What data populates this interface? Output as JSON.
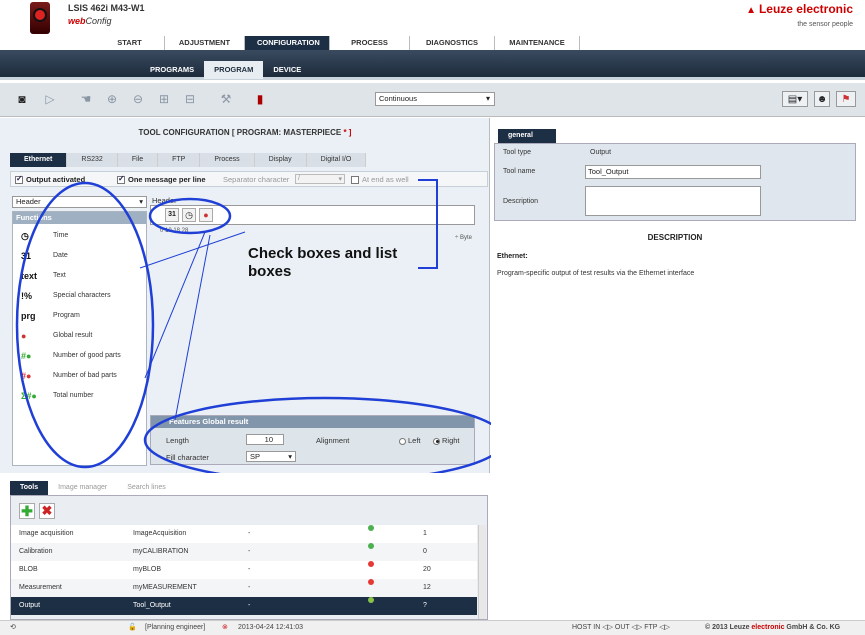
{
  "header": {
    "device_title": "LSIS 462i M43-W1",
    "webconfig_prefix": "web",
    "webconfig_suffix": "Config",
    "brand": "Leuze electronic",
    "slogan": "the sensor people"
  },
  "main_nav": [
    "START",
    "ADJUSTMENT",
    "CONFIGURATION",
    "PROCESS",
    "DIAGNOSTICS",
    "MAINTENANCE"
  ],
  "sub_nav": [
    "PROGRAMS",
    "PROGRAM",
    "DEVICE"
  ],
  "toolbar": {
    "mode": "Continuous"
  },
  "tool_config": {
    "title": "TOOL CONFIGURATION   [ PROGRAM: MASTERPIECE",
    "title_mark": " * ]"
  },
  "tabs": [
    "Ethernet",
    "RS232",
    "File",
    "FTP",
    "Process",
    "Display",
    "Digital I/O"
  ],
  "options": {
    "output_activated": "Output activated",
    "one_message": "One message per line",
    "separator_label": "Separator character",
    "separator_value": "/",
    "at_end": "At end as well"
  },
  "header_select": "Header",
  "functions": {
    "title": "Functions",
    "items": [
      {
        "icon": "◷",
        "label": "Time"
      },
      {
        "icon": "31",
        "label": "Date"
      },
      {
        "icon": "text",
        "label": "Text"
      },
      {
        "icon": "!%",
        "label": "Special characters"
      },
      {
        "icon": "prg",
        "label": "Program"
      },
      {
        "icon": "●",
        "label": "Global result"
      },
      {
        "icon": "#●",
        "label": "Number of good parts"
      },
      {
        "icon": "#●",
        "label": "Number of bad parts"
      },
      {
        "icon": "Σ#●",
        "label": "Total number"
      }
    ]
  },
  "header_area": {
    "label": "Header",
    "ruler": "0      10     18    28",
    "bytes": "÷ Byte"
  },
  "annotation": "Check boxes and list boxes",
  "features": {
    "title": "Features   Global result",
    "length_label": "Length",
    "length_value": "10",
    "alignment_label": "Alignment",
    "align_left": "Left",
    "align_right": "Right",
    "fill_label": "Fill character",
    "fill_value": "SP"
  },
  "general": {
    "tab": "general",
    "tool_type_label": "Tool type",
    "tool_type_value": "Output",
    "tool_name_label": "Tool name",
    "tool_name_value": "Tool_Output",
    "description_label": "Description"
  },
  "description": {
    "title": "DESCRIPTION",
    "heading": "Ethernet:",
    "text": "Program-specific output of test results via the Ethernet interface"
  },
  "bottom_tabs": [
    "Tools",
    "Image manager",
    "Search lines"
  ],
  "tools": [
    {
      "name": "Image acquisition",
      "id": "ImageAcquisition",
      "desc": "-",
      "color": "#4caf50",
      "count": "1"
    },
    {
      "name": "Calibration",
      "id": "myCALIBRATION",
      "desc": "-",
      "color": "#4caf50",
      "count": "0"
    },
    {
      "name": "BLOB",
      "id": "myBLOB",
      "desc": "-",
      "color": "#e53935",
      "count": "20"
    },
    {
      "name": "Measurement",
      "id": "myMEASUREMENT",
      "desc": "-",
      "color": "#e53935",
      "count": "12"
    },
    {
      "name": "Output",
      "id": "Tool_Output",
      "desc": "-",
      "color": "#8bc34a",
      "count": "?"
    }
  ],
  "status": {
    "user": "[Planning engineer]",
    "timestamp": "2013-04-24 12:41:03",
    "io": "HOST IN ◁▷   OUT ◁▷   FTP ◁▷",
    "copyright_prefix": "© 2013 Leuze ",
    "copyright_brand": "electronic",
    "copyright_suffix": " GmbH & Co. KG"
  }
}
